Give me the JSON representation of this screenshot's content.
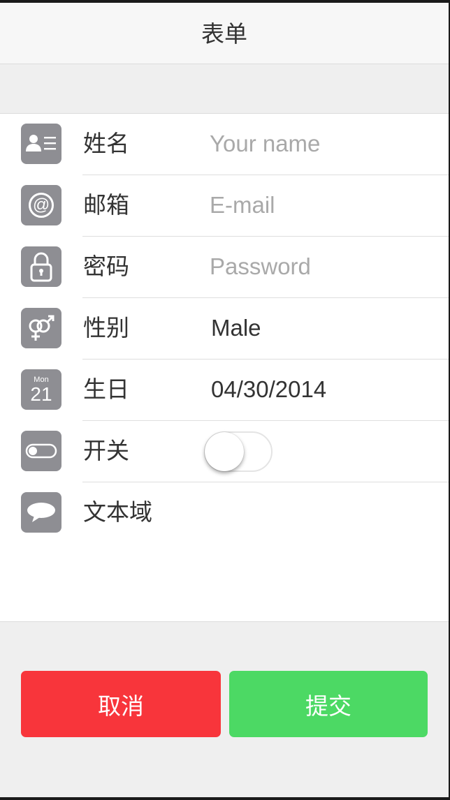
{
  "nav": {
    "title": "表单"
  },
  "form": {
    "rows": [
      {
        "label": "姓名",
        "placeholder": "Your name",
        "icon": "contact-card-icon"
      },
      {
        "label": "邮箱",
        "placeholder": "E-mail",
        "icon": "at-icon"
      },
      {
        "label": "密码",
        "placeholder": "Password",
        "icon": "lock-icon"
      },
      {
        "label": "性别",
        "value": "Male",
        "icon": "gender-icon"
      },
      {
        "label": "生日",
        "value": "04/30/2014",
        "icon": "calendar-icon",
        "calendar_month": "Mon",
        "calendar_day": "21"
      },
      {
        "label": "开关",
        "toggle_on": false,
        "icon": "toggle-icon"
      },
      {
        "label": "文本域",
        "icon": "speech-bubble-icon"
      }
    ]
  },
  "buttons": {
    "cancel": "取消",
    "submit": "提交"
  },
  "colors": {
    "icon_bg": "#8e8e93",
    "cancel": "#f8353b",
    "submit": "#4cd964"
  }
}
